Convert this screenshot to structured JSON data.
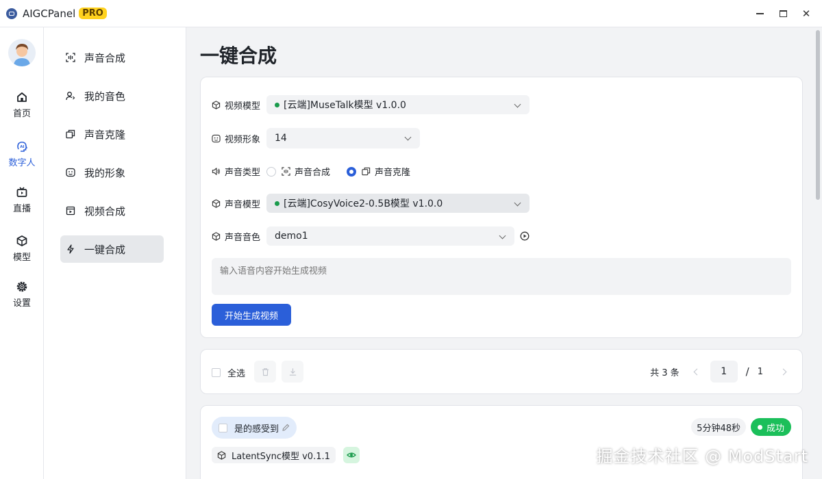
{
  "window": {
    "app_name": "AIGCPanel",
    "badge": "PRO",
    "controls": [
      "minimize-icon",
      "maximize-icon",
      "close-icon"
    ],
    "close_glyph": "✕"
  },
  "leftnav": {
    "items": [
      {
        "label": "首页",
        "icon": "home-icon",
        "active": false
      },
      {
        "label": "数字人",
        "icon": "ai-face-icon",
        "active": true
      },
      {
        "label": "直播",
        "icon": "tv-icon",
        "active": false
      },
      {
        "label": "模型",
        "icon": "cube-icon",
        "active": false
      },
      {
        "label": "设置",
        "icon": "gear-icon",
        "active": false
      }
    ]
  },
  "subnav": {
    "items": [
      {
        "label": "声音合成",
        "icon": "scan-icon",
        "active": false
      },
      {
        "label": "我的音色",
        "icon": "user-voice-icon",
        "active": false
      },
      {
        "label": "声音克隆",
        "icon": "clone-icon",
        "active": false
      },
      {
        "label": "我的形象",
        "icon": "face-icon",
        "active": false
      },
      {
        "label": "视频合成",
        "icon": "video-icon",
        "active": false
      },
      {
        "label": "一键合成",
        "icon": "bolt-icon",
        "active": true
      }
    ]
  },
  "main": {
    "title": "一键合成",
    "form": {
      "video_model_label": "视频模型",
      "video_model_value": "[云端]MuseTalk模型 v1.0.0",
      "video_avatar_label": "视频形象",
      "video_avatar_value": "14",
      "voice_type_label": "声音类型",
      "voice_type_options": [
        {
          "label": "声音合成",
          "selected": false
        },
        {
          "label": "声音克隆",
          "selected": true
        }
      ],
      "voice_model_label": "声音模型",
      "voice_model_value": "[云端]CosyVoice2-0.5B模型 v1.0.0",
      "voice_timbre_label": "声音音色",
      "voice_timbre_value": "demo1",
      "text_placeholder": "输入语音内容开始生成视频",
      "submit_label": "开始生成视频"
    },
    "toolbar": {
      "select_all_label": "全选",
      "total_label": "共 3 条",
      "current_page": "1",
      "page_sep": "/",
      "total_pages": "1"
    },
    "record": {
      "title": "是的感受到",
      "duration": "5分钟48秒",
      "status": "成功",
      "model_tag": "LatentSync模型 v0.1.1"
    }
  },
  "watermark": "掘金技术社区 @ ModStart",
  "colors": {
    "primary": "#2b5fd9",
    "success": "#1bbf5a",
    "pro_badge": "#ffd21e",
    "online_dot": "#1a9b4c"
  }
}
